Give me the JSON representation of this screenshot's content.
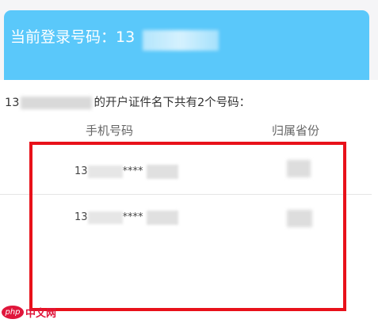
{
  "header": {
    "current_login_label": "当前登录号码：13",
    "background_color": "#5ac8fa"
  },
  "summary": {
    "prefix": "13",
    "text": "的开户证件名下共有2个号码："
  },
  "table": {
    "columns": [
      "手机号码",
      "归属省份"
    ],
    "rows": [
      {
        "phone_prefix": "13",
        "phone_mask": "****"
      },
      {
        "phone_prefix": "13",
        "phone_mask": "****"
      }
    ]
  },
  "highlight_box_color": "#e8111a",
  "watermark": {
    "logo": "php",
    "site": "中文网"
  }
}
